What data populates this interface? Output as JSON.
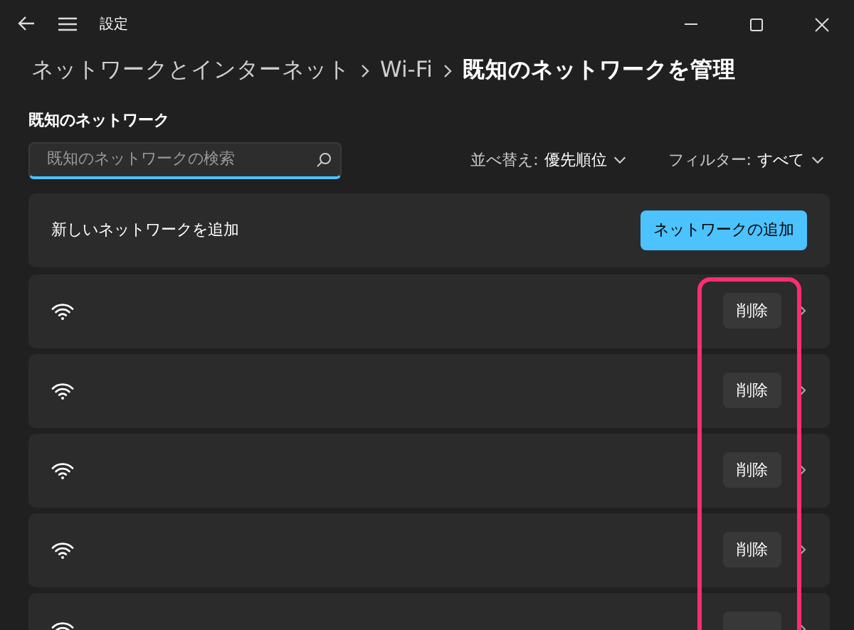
{
  "window": {
    "title": "設定"
  },
  "breadcrumb": [
    {
      "label": "ネットワークとインターネット",
      "current": false
    },
    {
      "label": "Wi-Fi",
      "current": false
    },
    {
      "label": "既知のネットワークを管理",
      "current": true
    }
  ],
  "section_title": "既知のネットワーク",
  "search": {
    "placeholder": "既知のネットワークの検索"
  },
  "sort": {
    "label": "並べ替え:",
    "value": "優先順位"
  },
  "filter": {
    "label": "フィルター:",
    "value": "すべて"
  },
  "add_card": {
    "text": "新しいネットワークを追加",
    "button": "ネットワークの追加"
  },
  "networks": [
    {
      "kind": "full",
      "delete_label": "削除"
    },
    {
      "kind": "full",
      "delete_label": "削除"
    },
    {
      "kind": "full",
      "delete_label": "削除"
    },
    {
      "kind": "full",
      "delete_label": "削除"
    },
    {
      "kind": "cut"
    }
  ]
}
